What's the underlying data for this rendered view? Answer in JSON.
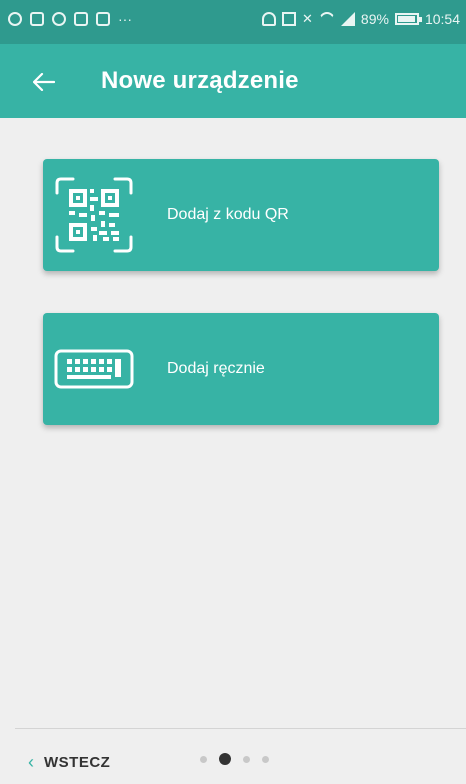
{
  "status_bar": {
    "battery_text": "89%",
    "time": "10:54",
    "more": "···"
  },
  "app_bar": {
    "title": "Nowe urządzenie",
    "back_icon": "arrow-left-icon",
    "color": "#37b3a5"
  },
  "options": [
    {
      "label": "Dodaj z kodu QR",
      "icon": "qr-code-icon"
    },
    {
      "label": "Dodaj ręcznie",
      "icon": "keyboard-icon"
    }
  ],
  "bottom": {
    "back_label": "WSTECZ",
    "pager": {
      "total": 4,
      "current": 2
    }
  }
}
